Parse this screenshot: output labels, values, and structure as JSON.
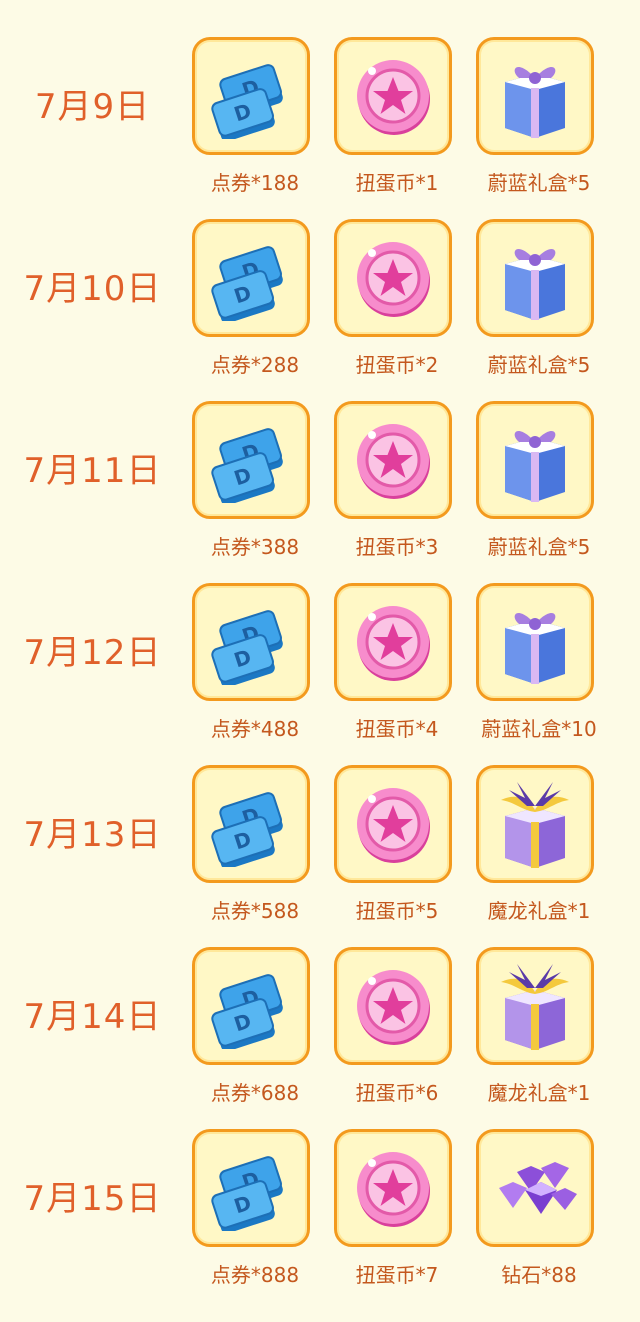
{
  "rows": [
    {
      "date": "7月9日",
      "rewards": [
        {
          "label": "点券*188",
          "icon": "ticket-icon"
        },
        {
          "label": "扭蛋币*1",
          "icon": "gacha-coin-icon"
        },
        {
          "label": "蔚蓝礼盒*5",
          "icon": "blue-gift-box-icon"
        }
      ]
    },
    {
      "date": "7月10日",
      "rewards": [
        {
          "label": "点券*288",
          "icon": "ticket-icon"
        },
        {
          "label": "扭蛋币*2",
          "icon": "gacha-coin-icon"
        },
        {
          "label": "蔚蓝礼盒*5",
          "icon": "blue-gift-box-icon"
        }
      ]
    },
    {
      "date": "7月11日",
      "rewards": [
        {
          "label": "点券*388",
          "icon": "ticket-icon"
        },
        {
          "label": "扭蛋币*3",
          "icon": "gacha-coin-icon"
        },
        {
          "label": "蔚蓝礼盒*5",
          "icon": "blue-gift-box-icon"
        }
      ]
    },
    {
      "date": "7月12日",
      "rewards": [
        {
          "label": "点券*488",
          "icon": "ticket-icon"
        },
        {
          "label": "扭蛋币*4",
          "icon": "gacha-coin-icon"
        },
        {
          "label": "蔚蓝礼盒*10",
          "icon": "blue-gift-box-icon"
        }
      ]
    },
    {
      "date": "7月13日",
      "rewards": [
        {
          "label": "点券*588",
          "icon": "ticket-icon"
        },
        {
          "label": "扭蛋币*5",
          "icon": "gacha-coin-icon"
        },
        {
          "label": "魔龙礼盒*1",
          "icon": "dragon-gift-box-icon"
        }
      ]
    },
    {
      "date": "7月14日",
      "rewards": [
        {
          "label": "点券*688",
          "icon": "ticket-icon"
        },
        {
          "label": "扭蛋币*6",
          "icon": "gacha-coin-icon"
        },
        {
          "label": "魔龙礼盒*1",
          "icon": "dragon-gift-box-icon"
        }
      ]
    },
    {
      "date": "7月15日",
      "rewards": [
        {
          "label": "点券*888",
          "icon": "ticket-icon"
        },
        {
          "label": "扭蛋币*7",
          "icon": "gacha-coin-icon"
        },
        {
          "label": "钻石*88",
          "icon": "diamond-icon"
        }
      ]
    }
  ],
  "colors": {
    "background": "#fdfbe6",
    "tile_border": "#f39a1e",
    "tile_fill": "#fff8c6",
    "date_text": "#e0602a",
    "label_text": "#c4581e"
  }
}
